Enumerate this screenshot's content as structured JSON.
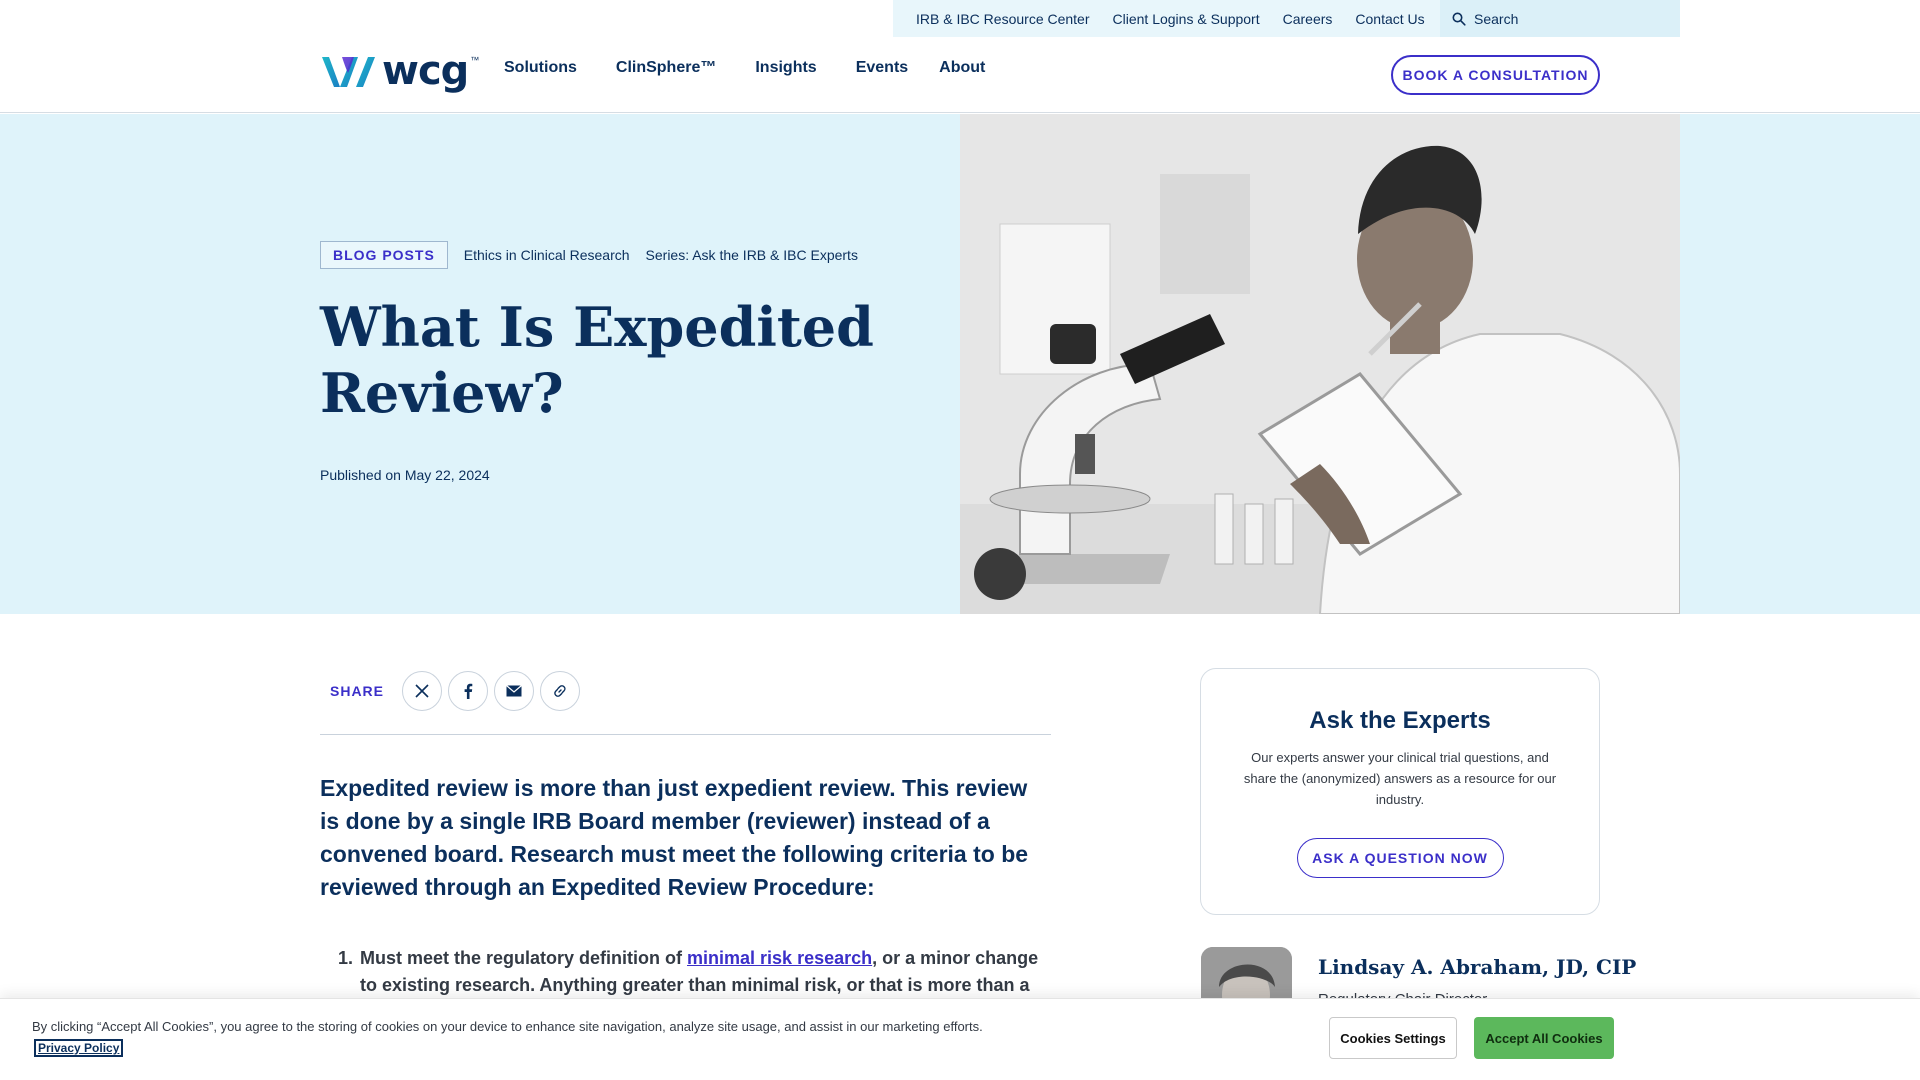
{
  "utility_nav": {
    "links": [
      "IRB & IBC Resource Center",
      "Client Logins & Support",
      "Careers",
      "Contact Us"
    ],
    "search_label": "Search"
  },
  "brand": {
    "name": "wcg",
    "trademark": "™",
    "accent": "#3b2fc9",
    "navy": "#0b2f5c"
  },
  "main_nav": {
    "items": [
      "Solutions",
      "ClinSphere™",
      "Insights",
      "Events",
      "About"
    ],
    "cta": "BOOK A CONSULTATION"
  },
  "hero": {
    "badge": "BLOG POSTS",
    "tags": [
      "Ethics in Clinical Research",
      "Series: Ask the IRB & IBC Experts"
    ],
    "title": "What Is Expedited Review?",
    "published": "Published on May 22, 2024",
    "background": "#dff3fa"
  },
  "share": {
    "label": "SHARE",
    "icons": [
      "x-icon",
      "facebook-icon",
      "email-icon",
      "link-icon"
    ]
  },
  "article": {
    "lead": "Expedited review is more than just expedient review. This review is done by a single IRB Board member (reviewer) instead of a convened board. Research must meet the following criteria to be reviewed through an Expedited Review Procedure:",
    "list": [
      {
        "number": "1.",
        "before": "Must meet the regulatory definition of ",
        "link": "minimal risk research",
        "after": ", or a minor change to existing research. Anything greater than minimal risk, or that is more than a"
      }
    ]
  },
  "sidebar": {
    "experts_title": "Ask the Experts",
    "experts_body": "Our experts answer your clinical trial questions, and share the (anonymized) answers as a resource for our industry.",
    "experts_cta": "ASK A QUESTION NOW",
    "author_name": "Lindsay A. Abraham, JD, CIP",
    "author_role": "Regulatory Chair Director"
  },
  "cookie_banner": {
    "text": "By clicking “Accept All Cookies”, you agree to the storing of cookies on your device to enhance site navigation, analyze site usage, and assist in our marketing efforts.",
    "privacy_link": "Privacy Policy",
    "settings_button": "Cookies Settings",
    "accept_button": "Accept All Cookies",
    "accept_color": "#5cb85c"
  }
}
